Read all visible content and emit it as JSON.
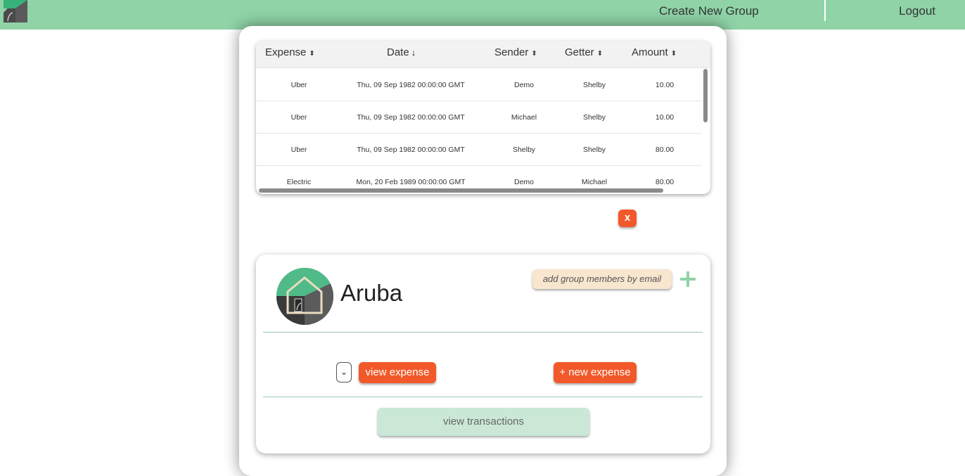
{
  "nav": {
    "create_group": "Create New Group",
    "logout": "Logout",
    "logo_icon": "house-logo-icon"
  },
  "table": {
    "headers": {
      "expense": "Expense",
      "date": "Date",
      "sender": "Sender",
      "getter": "Getter",
      "amount": "Amount"
    },
    "sort_icons": {
      "unsorted": "⬍",
      "descending": "↓"
    },
    "rows": [
      {
        "expense": "Uber",
        "date": "Thu, 09 Sep 1982 00:00:00 GMT",
        "sender": "Demo",
        "getter": "Shelby",
        "amount": "10.00"
      },
      {
        "expense": "Uber",
        "date": "Thu, 09 Sep 1982 00:00:00 GMT",
        "sender": "Michael",
        "getter": "Shelby",
        "amount": "10.00"
      },
      {
        "expense": "Uber",
        "date": "Thu, 09 Sep 1982 00:00:00 GMT",
        "sender": "Shelby",
        "getter": "Shelby",
        "amount": "80.00"
      },
      {
        "expense": "Electric",
        "date": "Mon, 20 Feb 1989 00:00:00 GMT",
        "sender": "Demo",
        "getter": "Michael",
        "amount": "80.00"
      }
    ]
  },
  "close_label": "x",
  "group": {
    "name": "Aruba",
    "email_placeholder": "add group members by email",
    "select_chevron": "⌄",
    "view_expense": "view expense",
    "new_expense": "+ new expense",
    "view_transactions": "view transactions"
  },
  "colors": {
    "topbar": "#8fd3a7",
    "accent_orange": "#f2592a",
    "email_bg": "#f8e6cf",
    "transactions_bg": "#cbe8d7",
    "plus_green": "#8fd3a7"
  }
}
